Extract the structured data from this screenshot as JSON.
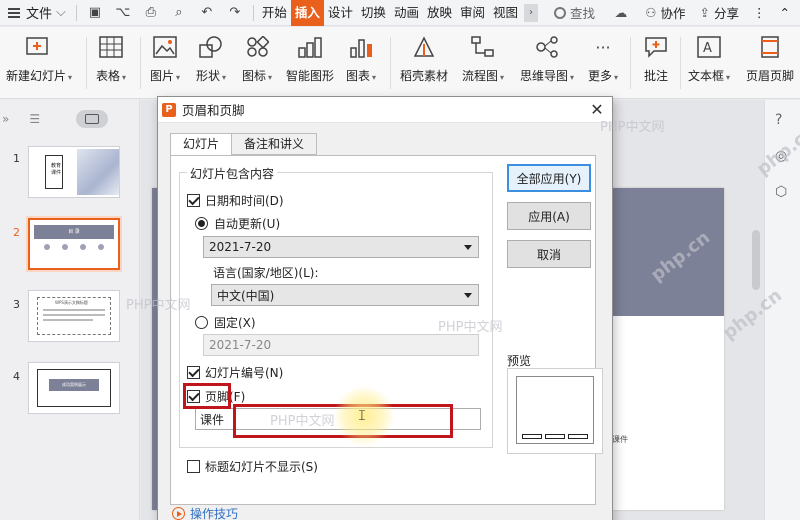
{
  "menubar": {
    "file_label": "文件",
    "tabs": [
      "开始",
      "插入",
      "设计",
      "切换",
      "动画",
      "放映",
      "审阅",
      "视图"
    ],
    "active_tab": "插入",
    "search_label": "查找",
    "collab_label": "协作",
    "share_label": "分享"
  },
  "ribbon": {
    "new_slide": "新建幻灯片",
    "table": "表格",
    "picture": "图片",
    "shape": "形状",
    "icon": "图标",
    "smartart": "智能图形",
    "chart": "图表",
    "docer": "稻壳素材",
    "flowchart": "流程图",
    "mindmap": "思维导图",
    "more": "更多",
    "comment": "批注",
    "textbox": "文本框",
    "header_footer": "页眉页脚"
  },
  "thumbnails": {
    "numbers": [
      "1",
      "2",
      "3",
      "4"
    ],
    "selected": "2",
    "slide1_title": "教育课件",
    "slide2_title": "目 录",
    "slide3_title": "WPS演示文稿标题",
    "slide4_title": "成功案例展示"
  },
  "slide": {
    "footer_text": "课件"
  },
  "dialog": {
    "title": "页眉和页脚",
    "tabs": [
      "幻灯片",
      "备注和讲义"
    ],
    "active_tab": "幻灯片",
    "group_label": "幻灯片包含内容",
    "date_time_label": "日期和时间(D)",
    "auto_update_label": "自动更新(U)",
    "auto_date_value": "2021-7-20",
    "language_label": "语言(国家/地区)(L):",
    "language_value": "中文(中国)",
    "fixed_label": "固定(X)",
    "fixed_date_value": "2021-7-20",
    "slide_number_label": "幻灯片编号(N)",
    "footer_label": "页脚(F)",
    "footer_value": "课件",
    "hide_on_title_label": "标题幻灯片不显示(S)",
    "apply_all_button": "全部应用(Y)",
    "apply_button": "应用(A)",
    "cancel_button": "取消",
    "preview_label": "预览",
    "tips_link": "操作技巧",
    "checked": {
      "date_time": true,
      "auto_update": true,
      "fixed": false,
      "slide_number": true,
      "footer": true,
      "hide_on_title": false
    }
  },
  "watermarks": {
    "text_cn": "PHP中文网",
    "text_en": "php.cn"
  },
  "colors": {
    "accent": "#e8601c",
    "highlight": "#c0161b",
    "slide_band": "#7d8197",
    "primary_button_border": "#3b8fe0"
  }
}
